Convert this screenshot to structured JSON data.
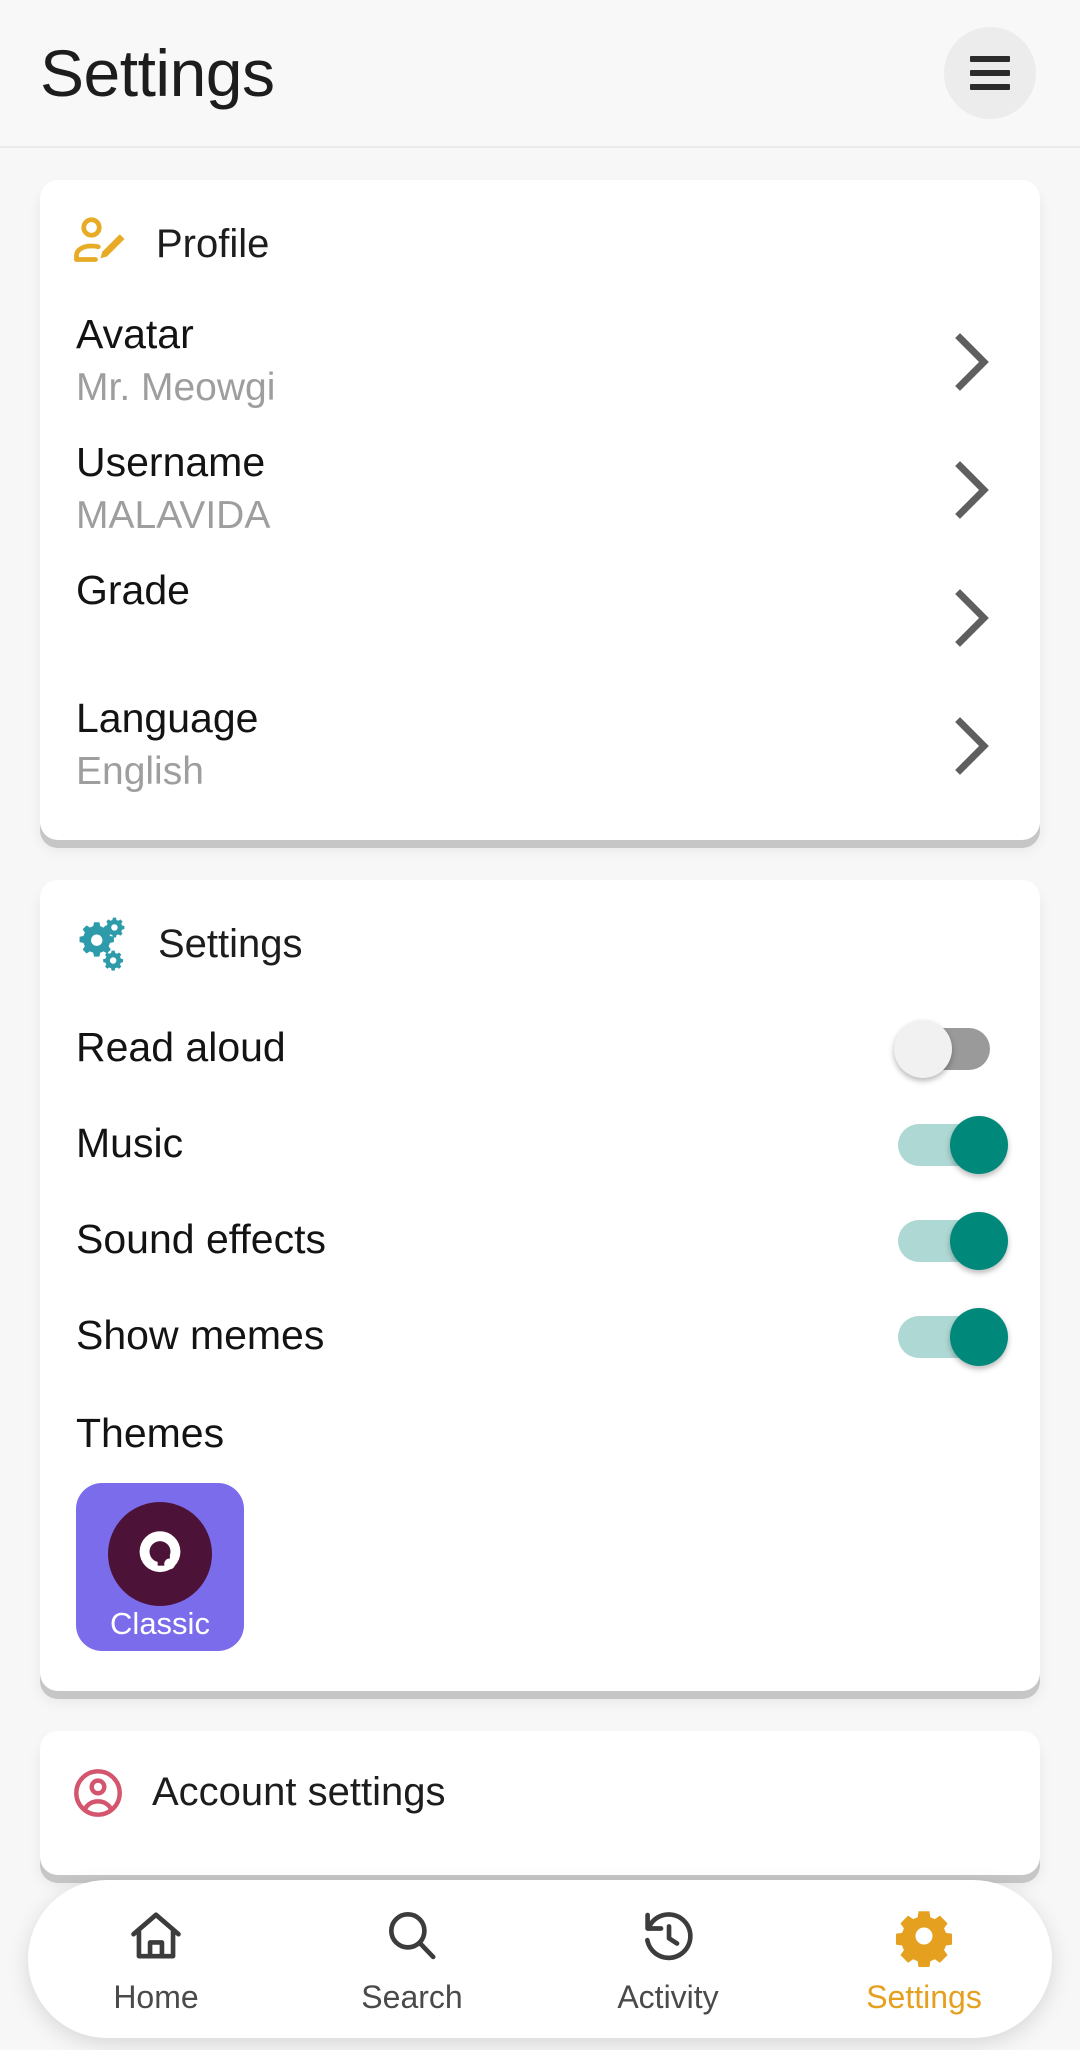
{
  "header": {
    "title": "Settings",
    "menu_icon": "hamburger-menu-icon"
  },
  "colors": {
    "background": "#f7f7f7",
    "card": "#ffffff",
    "profile_icon": "#e8ab26",
    "settings_icon": "#2e9bab",
    "account_icon": "#d4566e",
    "toggle_on": "#00897b",
    "toggle_on_track": "#aed8d4",
    "toggle_off_track": "#9a9a9a",
    "theme_tile": "#7b6ceb",
    "theme_logo": "#4d1238",
    "active_nav": "#e5a020",
    "muted_text": "#9e9e9e"
  },
  "profile_card": {
    "icon": "profile-edit-icon",
    "title": "Profile",
    "rows": [
      {
        "label": "Avatar",
        "value": "Mr. Meowgi",
        "chevron": "chevron-right-icon"
      },
      {
        "label": "Username",
        "value": "MALAVIDA",
        "chevron": "chevron-right-icon"
      },
      {
        "label": "Grade",
        "value": "",
        "chevron": "chevron-right-icon"
      },
      {
        "label": "Language",
        "value": "English",
        "chevron": "chevron-right-icon"
      }
    ]
  },
  "settings_card": {
    "icon": "gears-icon",
    "title": "Settings",
    "toggles": [
      {
        "label": "Read aloud",
        "state": "off"
      },
      {
        "label": "Music",
        "state": "on"
      },
      {
        "label": "Sound effects",
        "state": "on"
      },
      {
        "label": "Show memes",
        "state": "on"
      }
    ],
    "themes_label": "Themes",
    "themes": [
      {
        "name": "Classic",
        "logo": "q-logo-icon",
        "selected": true
      }
    ]
  },
  "account_card": {
    "icon": "account-circle-icon",
    "title": "Account settings"
  },
  "bottom_nav": {
    "items": [
      {
        "label": "Home",
        "icon": "home-icon",
        "active": false
      },
      {
        "label": "Search",
        "icon": "search-icon",
        "active": false
      },
      {
        "label": "Activity",
        "icon": "history-icon",
        "active": false
      },
      {
        "label": "Settings",
        "icon": "gear-icon",
        "active": true
      }
    ]
  }
}
